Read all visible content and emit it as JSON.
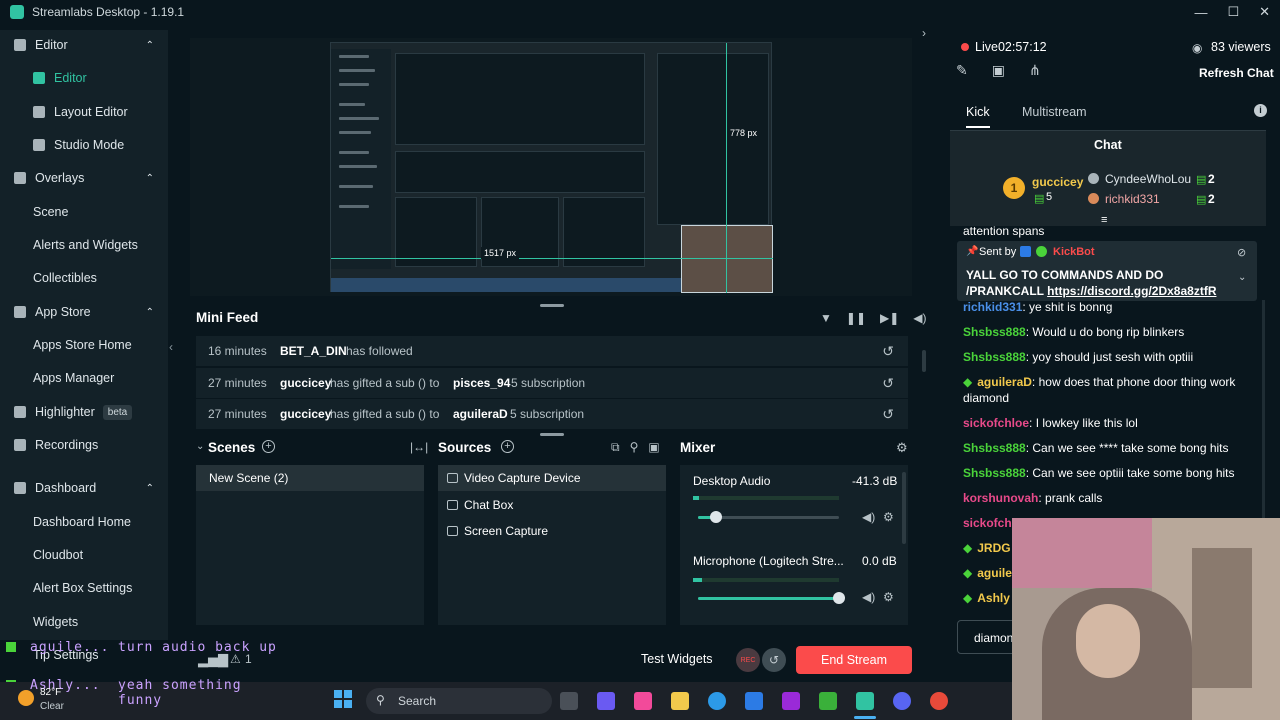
{
  "window": {
    "title": "Streamlabs Desktop - 1.19.1",
    "minimize": "—",
    "maximize": "☐",
    "close": "✕"
  },
  "sidebar": {
    "items": [
      {
        "label": "Editor",
        "type": "group"
      },
      {
        "label": "Editor",
        "type": "sub",
        "active": true
      },
      {
        "label": "Layout Editor",
        "type": "sub"
      },
      {
        "label": "Studio Mode",
        "type": "sub"
      },
      {
        "label": "Overlays",
        "type": "group"
      },
      {
        "label": "Scene",
        "type": "sub-plain"
      },
      {
        "label": "Alerts and Widgets",
        "type": "sub-plain"
      },
      {
        "label": "Collectibles",
        "type": "sub-plain"
      },
      {
        "label": "App Store",
        "type": "group"
      },
      {
        "label": "Apps Store Home",
        "type": "sub-plain"
      },
      {
        "label": "Apps Manager",
        "type": "sub-plain"
      },
      {
        "label": "Highlighter",
        "type": "group",
        "badge": "beta"
      },
      {
        "label": "Recordings",
        "type": "group"
      },
      {
        "label": "Dashboard",
        "type": "group"
      },
      {
        "label": "Dashboard Home",
        "type": "sub-plain"
      },
      {
        "label": "Cloudbot",
        "type": "sub-plain"
      },
      {
        "label": "Alert Box Settings",
        "type": "sub-plain"
      },
      {
        "label": "Widgets",
        "type": "sub-plain"
      },
      {
        "label": "Tip Settings",
        "type": "sub-plain"
      }
    ]
  },
  "preview": {
    "width_label": "1517 px",
    "height_label": "778 px"
  },
  "minifeed": {
    "title": "Mini Feed",
    "rows": [
      {
        "time": "16 minutes",
        "user": "BET_A_DIN",
        "text": "has followed",
        "target": "",
        "extra": ""
      },
      {
        "time": "27 minutes",
        "user": "guccicey",
        "text": "has gifted a sub () to",
        "target": "pisces_94",
        "extra": "5 subscription"
      },
      {
        "time": "27 minutes",
        "user": "guccicey",
        "text": "has gifted a sub () to",
        "target": "aguileraD",
        "extra": "5 subscription"
      }
    ]
  },
  "scenes": {
    "title": "Scenes",
    "items": [
      "New Scene (2)"
    ]
  },
  "sources": {
    "title": "Sources",
    "items": [
      "Video Capture Device",
      "Chat Box",
      "Screen Capture"
    ]
  },
  "mixer": {
    "title": "Mixer",
    "channels": [
      {
        "name": "Desktop Audio",
        "db": "-41.3 dB",
        "level": 0.1
      },
      {
        "name": "Microphone (Logitech Stre...",
        "db": "0.0 dB",
        "level": 1.0
      }
    ]
  },
  "footer": {
    "test_widgets": "Test Widgets",
    "rec": "REC",
    "end_stream": "End Stream",
    "alerts_count": "1"
  },
  "stream": {
    "live_label": "Live",
    "duration": "02:57:12",
    "viewers": "83 viewers",
    "refresh_chat": "Refresh Chat"
  },
  "chat_tabs": {
    "kick": "Kick",
    "multistream": "Multistream",
    "chat_title": "Chat"
  },
  "leaderboard": {
    "top": {
      "rank": "1",
      "name": "guccicey",
      "count": "5"
    },
    "others": [
      {
        "name": "CyndeeWhoLou",
        "count": "2"
      },
      {
        "name": "richkid331",
        "count": "2"
      }
    ]
  },
  "pinned": {
    "partial_above": "attention spans",
    "sent_by_label": "Sent by",
    "sender": "KickBot",
    "text": "YALL GO TO COMMANDS AND DO /PRANKCALL",
    "link": "https://discord.gg/2Dx8a8ztfR"
  },
  "chat": [
    {
      "user": "richkid331",
      "color": "#4a8fe8",
      "text": "ye shit is bonng",
      "badge": false
    },
    {
      "user": "Shsbss888",
      "color": "#4ad33a",
      "text": "Would u do bong rip blinkers",
      "badge": false
    },
    {
      "user": "Shsbss888",
      "color": "#4ad33a",
      "text": "yoy should just sesh with optiii",
      "badge": false
    },
    {
      "user": "aguileraD",
      "color": "#f2c94c",
      "text": "how does that phone door thing work diamond",
      "badge": true
    },
    {
      "user": "sickofchloe",
      "color": "#e84a8a",
      "text": "I lowkey like this lol",
      "badge": false
    },
    {
      "user": "Shsbss888",
      "color": "#4ad33a",
      "text": "Can we see **** take some bong hits",
      "badge": false
    },
    {
      "user": "Shsbss888",
      "color": "#4ad33a",
      "text": "Can we see optiii take some bong hits",
      "badge": false
    },
    {
      "user": "korshunovah",
      "color": "#e84a8a",
      "text": "prank calls",
      "badge": false
    },
    {
      "user": "sickofchl",
      "color": "#e84a8a",
      "text": "",
      "badge": false
    },
    {
      "user": "JRDG",
      "color": "#f2c94c",
      "text": "",
      "badge": true
    },
    {
      "user": "aguile",
      "color": "#f2c94c",
      "text": "",
      "badge": true
    },
    {
      "user": "Ashly",
      "color": "#f2c94c",
      "text": "",
      "badge": true
    }
  ],
  "chat_input": {
    "value": "diamon"
  },
  "overlay": {
    "line1_user": "aguile...",
    "line1_text": "turn audio back up",
    "line2_user": "Ashly...",
    "line2_text": "yeah something funny"
  },
  "taskbar": {
    "search_placeholder": "Search",
    "weather_temp": "82°F",
    "weather_desc": "Clear"
  }
}
